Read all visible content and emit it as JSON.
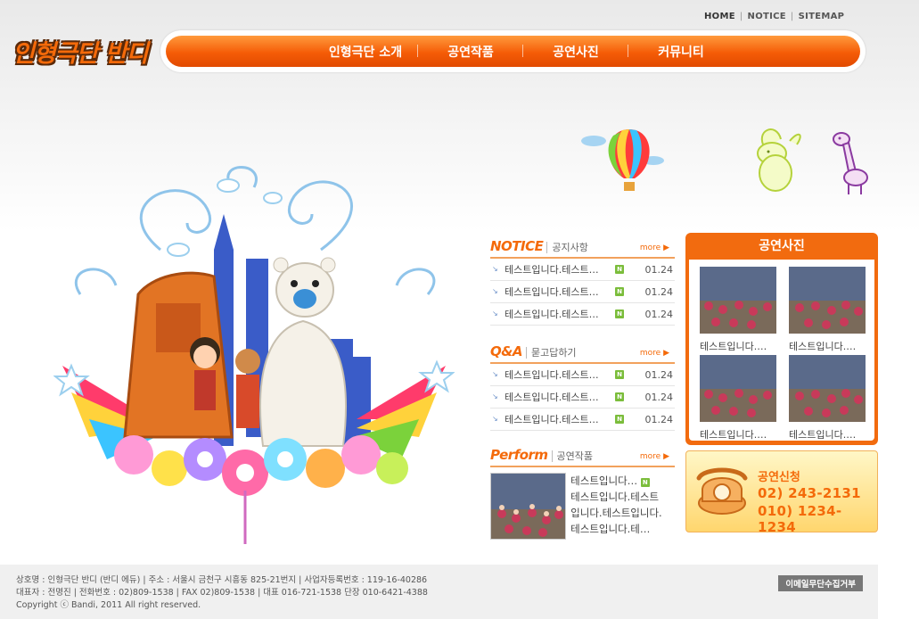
{
  "top_links": {
    "home": "HOME",
    "notice": "NOTICE",
    "sitemap": "SITEMAP"
  },
  "logo": {
    "text": "인형극단 반디"
  },
  "nav": {
    "items": [
      "인형극단 소개",
      "공연작품",
      "공연사진",
      "커뮤니티"
    ]
  },
  "notice": {
    "title": "NOTICE",
    "subtitle": "공지사항",
    "more": "more ▶",
    "rows": [
      {
        "text": "테스트입니다.테스트…",
        "date": "01.24"
      },
      {
        "text": "테스트입니다.테스트…",
        "date": "01.24"
      },
      {
        "text": "테스트입니다.테스트…",
        "date": "01.24"
      }
    ]
  },
  "qna": {
    "title": "Q&A",
    "subtitle": "묻고답하기",
    "more": "more ▶",
    "rows": [
      {
        "text": "테스트입니다.테스트…",
        "date": "01.24"
      },
      {
        "text": "테스트입니다.테스트…",
        "date": "01.24"
      },
      {
        "text": "테스트입니다.테스트…",
        "date": "01.24"
      }
    ]
  },
  "perform": {
    "title": "Perform",
    "subtitle": "공연작품",
    "more": "more ▶",
    "lines": [
      "테스트입니다…",
      "테스트입니다.테스트",
      "입니다.테스트입니다.",
      "테스트입니다.테…"
    ]
  },
  "photos": {
    "title": "공연사진",
    "captions": [
      "테스트입니다.…",
      "테스트입니다.…",
      "테스트입니다.…",
      "테스트입니다.…"
    ]
  },
  "apply": {
    "label": "공연신청",
    "phone1": "02) 243-2131",
    "phone2": "010) 1234-1234"
  },
  "badge_text": "N",
  "footer": {
    "line1": "상호명 : 인형극단 반디 (반디 에듀)  |  주소 : 서울시 금천구 시흥동 825-21번지  |  사업자등록번호 :  119-16-40286",
    "line2": "대표자 : 전명진   |   전화번호 : 02)809-1538   |   FAX 02)809-1538   |   대표 016-721-1538  단장  010-6421-4388",
    "line3": "Copyright ⓒ Bandi, 2011 All right reserved.",
    "email_refuse": "이메일무단수집거부"
  },
  "colors": {
    "accent": "#f46a0a",
    "nav": "#f55c07",
    "footer_bg": "#f0f0f0"
  }
}
